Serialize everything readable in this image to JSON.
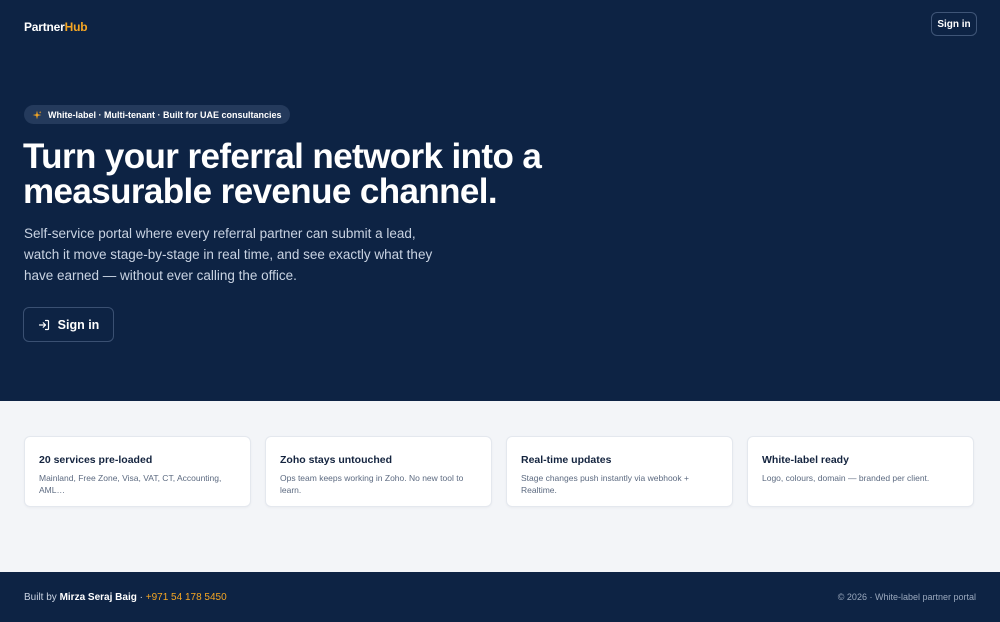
{
  "brand": {
    "name_main": "Partner",
    "name_accent": "Hub",
    "accent_color": "#f5a623"
  },
  "header": {
    "signin_label": "Sign in"
  },
  "hero": {
    "pill_icon": "sparkles-icon",
    "pill_text": "White-label · Multi-tenant · Built for UAE consultancies",
    "headline": "Turn your referral network into a measurable revenue channel.",
    "subtitle": "Self-service portal where every referral partner can submit a lead, watch it move stage-by-stage in real time, and see exactly what they have earned — without ever calling the office.",
    "cta_icon": "sign-in-icon",
    "cta_label": "Sign in",
    "background": "#0d2344"
  },
  "features": [
    {
      "title": "20 services pre-loaded",
      "desc": "Mainland, Free Zone, Visa, VAT, CT, Accounting, AML…"
    },
    {
      "title": "Zoho stays untouched",
      "desc": "Ops team keeps working in Zoho. No new tool to learn."
    },
    {
      "title": "Real-time updates",
      "desc": "Stage changes push instantly via webhook + Realtime."
    },
    {
      "title": "White-label ready",
      "desc": "Logo, colours, domain — branded per client."
    }
  ],
  "footer": {
    "built_by": "Built by",
    "author": "Mirza Seraj Baig",
    "separator": "·",
    "phone": "+971 54 178 5450",
    "copyright": "© 2026 · White-label partner portal"
  }
}
